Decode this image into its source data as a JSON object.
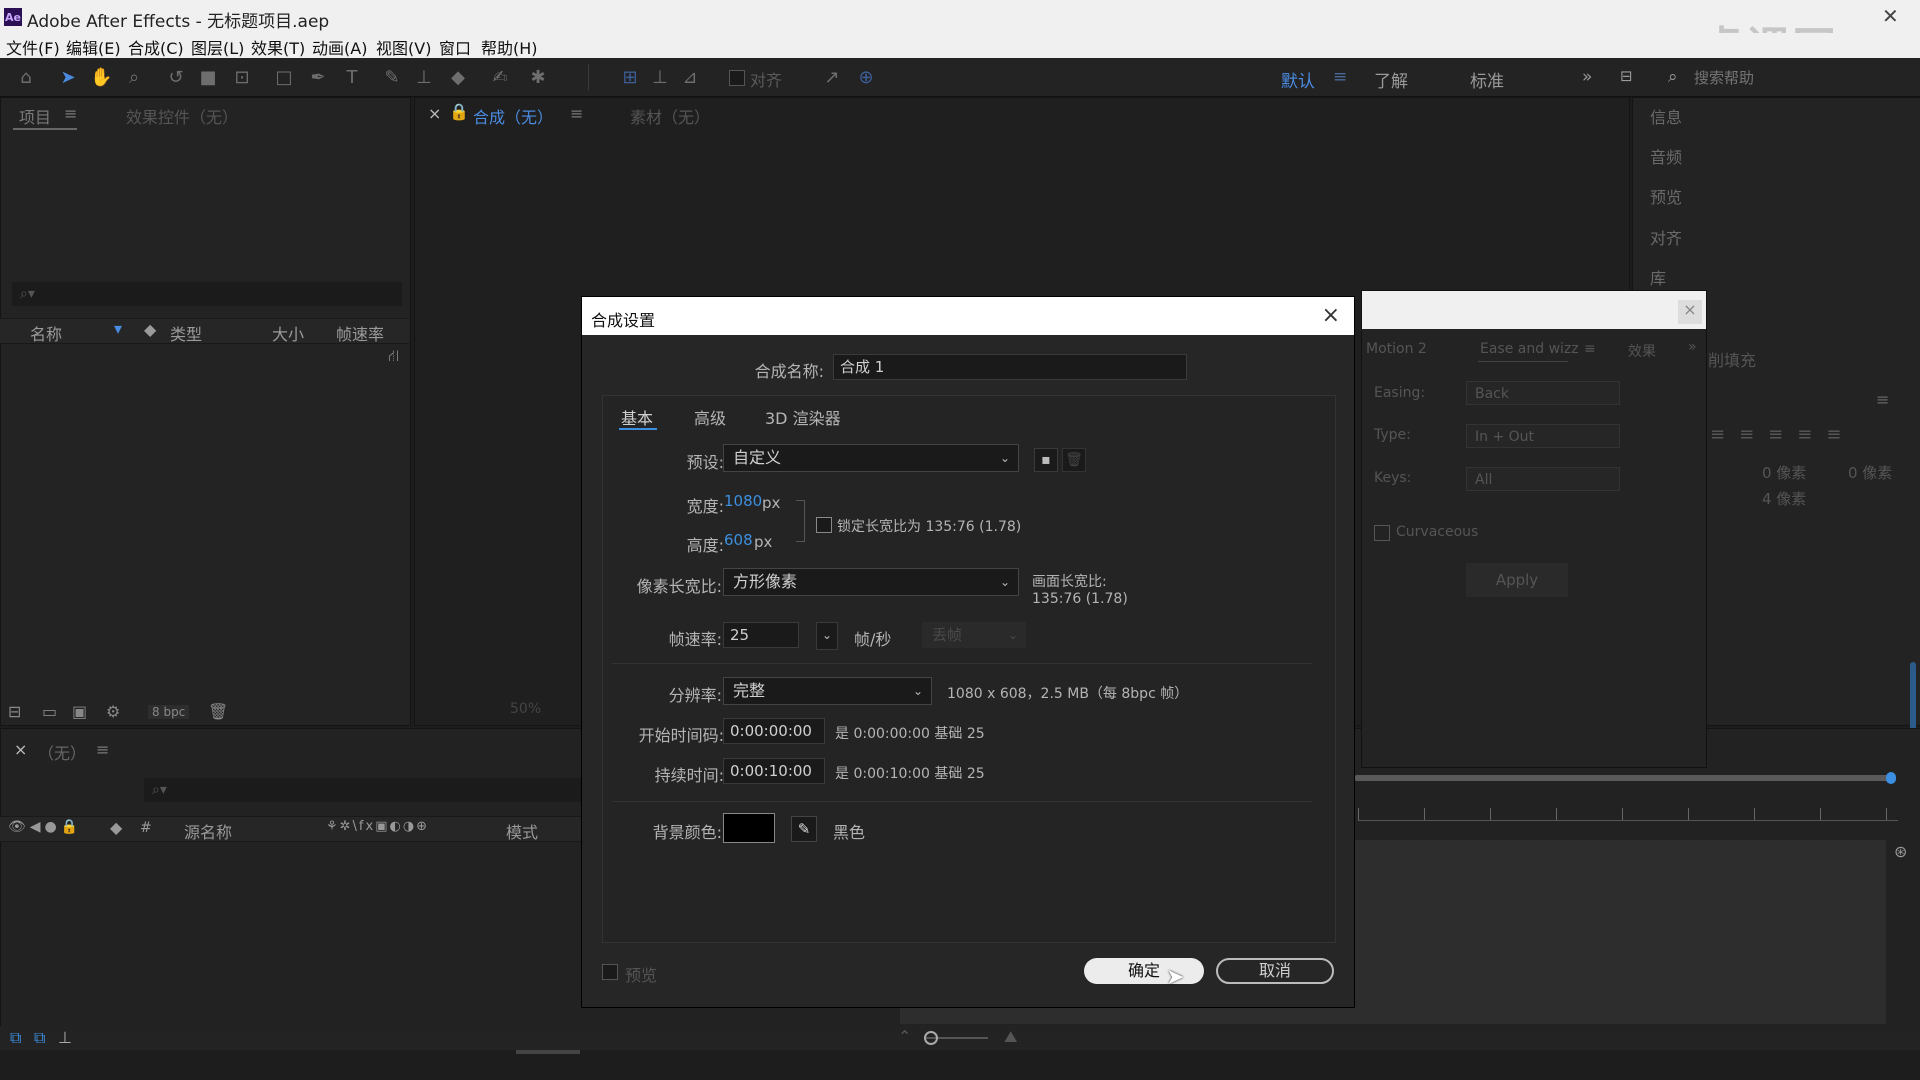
{
  "window": {
    "title": "Adobe After Effects - 无标题项目.aep",
    "app_icon": "Ae"
  },
  "menu": [
    "文件(F)",
    "编辑(E)",
    "合成(C)",
    "图层(L)",
    "效果(T)",
    "动画(A)",
    "视图(V)",
    "窗口",
    "帮助(H)"
  ],
  "toolbar": {
    "snap_label": "对齐"
  },
  "workspaces": {
    "items": [
      "默认",
      "了解",
      "标准"
    ],
    "active": "默认",
    "search_placeholder": "搜索帮助"
  },
  "project_panel": {
    "tabs": [
      "项目",
      "效果控件（无）"
    ],
    "columns": [
      "名称",
      "类型",
      "大小",
      "帧速率"
    ],
    "bpc": "8 bpc"
  },
  "comp_panel": {
    "tabs": [
      "合成（无）",
      "素材（无）"
    ],
    "zoom": "50%"
  },
  "timeline": {
    "tab": "（无）",
    "columns": [
      "源名称",
      "模式"
    ],
    "hash": "#"
  },
  "right_panels": [
    "信息",
    "音频",
    "预览",
    "对齐",
    "库"
  ],
  "paragraph": {
    "partial_fill": "削填充",
    "px_a": "0 像素",
    "px_b": "0 像素",
    "px_c": "4 像素"
  },
  "motion_panel": {
    "tabs": [
      "Motion 2",
      "Ease and wizz",
      "效果"
    ],
    "easing_label": "Easing:",
    "easing_value": "Back",
    "type_label": "Type:",
    "type_value": "In + Out",
    "keys_label": "Keys:",
    "keys_value": "All",
    "curvaceous": "Curvaceous",
    "apply": "Apply"
  },
  "dialog": {
    "title": "合成设置",
    "name_label": "合成名称:",
    "name_value": "合成 1",
    "tabs": [
      "基本",
      "高级",
      "3D 渲染器"
    ],
    "active_tab": "基本",
    "preset_label": "预设:",
    "preset_value": "自定义",
    "width_label": "宽度:",
    "width_value": "1080",
    "height_label": "高度:",
    "height_value": "608",
    "unit_px": "px",
    "lock_label": "锁定长宽比为 135:76 (1.78)",
    "par_label": "像素长宽比:",
    "par_value": "方形像素",
    "frame_aspect_label": "画面长宽比:",
    "frame_aspect_value": "135:76 (1.78)",
    "fps_label": "帧速率:",
    "fps_value": "25",
    "fps_unit": "帧/秒",
    "drop_frame": "丢帧",
    "res_label": "分辨率:",
    "res_value": "完整",
    "res_info": "1080 x 608，2.5 MB（每 8bpc 帧）",
    "start_label": "开始时间码:",
    "start_value": "0:00:00:00",
    "start_info": "是 0:00:00:00  基础 25",
    "dur_label": "持续时间:",
    "dur_value": "0:00:10:00",
    "dur_info": "是 0:00:10:00  基础 25",
    "bg_label": "背景颜色:",
    "bg_name": "黑色",
    "bg_color": "#000000",
    "preview_label": "预览",
    "ok": "确定",
    "cancel": "取消"
  },
  "watermark": "虎课网"
}
